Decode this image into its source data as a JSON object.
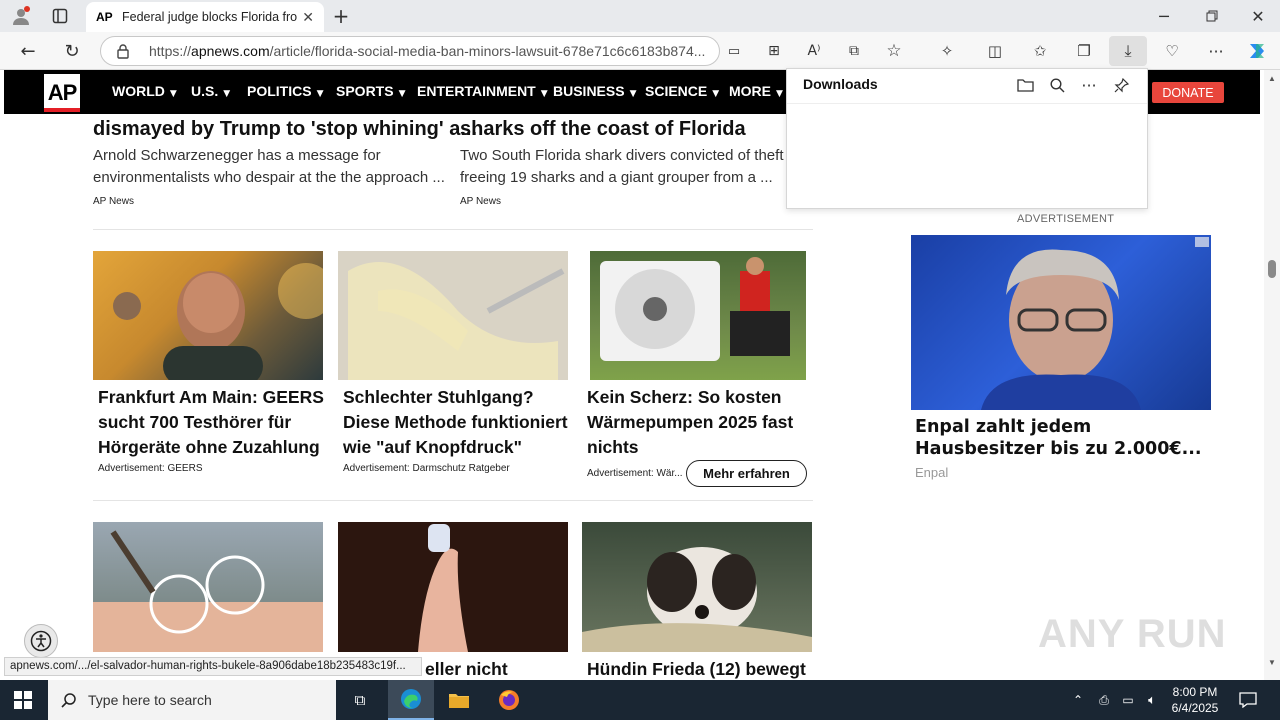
{
  "browser": {
    "tab_title": "Federal judge blocks Florida from",
    "tab_favicon": "AP",
    "url_prefix": "https://",
    "url_domain": "apnews.com",
    "url_path": "/article/florida-social-media-ban-minors-lawsuit-678e71c6c6183b874...",
    "downloads_title": "Downloads",
    "status_url": "apnews.com/.../el-salvador-human-rights-bukele-8a906dabe18b235483c19f..."
  },
  "site": {
    "logo": "AP",
    "nav": [
      "WORLD",
      "U.S.",
      "POLITICS",
      "SPORTS",
      "ENTERTAINMENT",
      "BUSINESS",
      "SCIENCE",
      "MORE"
    ],
    "donate": "DONATE"
  },
  "articles": [
    {
      "title": "dismayed by Trump to 'stop whining' a...",
      "desc1": "Arnold Schwarzenegger has a message for",
      "desc2": "environmentalists who despair at the the approach ...",
      "source": "AP News"
    },
    {
      "title": "sharks off the coast of Florida",
      "desc1": "Two South Florida shark divers convicted of theft f",
      "desc2": "freeing 19 sharks and a giant grouper from a ...",
      "source": "AP News"
    }
  ],
  "cards": [
    {
      "t1": "Frankfurt Am Main: GEERS",
      "t2": "sucht 700 Testhörer für",
      "t3": "Hörgeräte ohne Zuzahlung",
      "ad": "Advertisement:  GEERS"
    },
    {
      "t1": "Schlechter Stuhlgang?",
      "t2": "Diese Methode funktioniert",
      "t3": "wie \"auf Knopfdruck\"",
      "ad": "Advertisement:  Darmschutz Ratgeber"
    },
    {
      "t1": "Kein Scherz: So kosten",
      "t2": "Wärmepumpen 2025 fast",
      "t3": "nichts",
      "ad": "Advertisement:  Wär...",
      "cta": "Mehr erfahren"
    }
  ],
  "row3": [
    {
      "t1": ""
    },
    {
      "t1": "eller nicht"
    },
    {
      "t1": "Hündin Frieda (12) bewegt"
    }
  ],
  "sidebar_ad": {
    "label": "ADVERTISEMENT",
    "title1": "Enpal zahlt jedem",
    "title2": "Hausbesitzer bis zu 2.000€...",
    "source": "Enpal"
  },
  "watermark": "ANY RUN",
  "taskbar": {
    "search_placeholder": "Type here to search",
    "time": "8:00 PM",
    "date": "6/4/2025"
  }
}
